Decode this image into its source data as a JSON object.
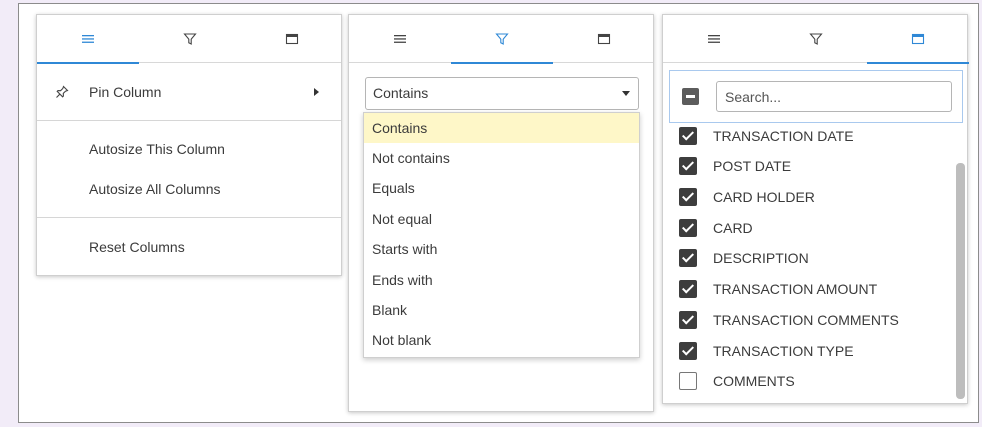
{
  "colors": {
    "accent": "#2f88d6",
    "selected_option": "#fef7c8",
    "checkbox": "#3d3d3d"
  },
  "tabs": [
    {
      "icon": "menu-lines-icon"
    },
    {
      "icon": "filter-funnel-icon"
    },
    {
      "icon": "columns-icon"
    }
  ],
  "general_menu": {
    "pin_column": "Pin Column",
    "autosize_this": "Autosize This Column",
    "autosize_all": "Autosize All Columns",
    "reset_columns": "Reset Columns"
  },
  "filter": {
    "selected": "Contains",
    "options": [
      "Contains",
      "Not contains",
      "Equals",
      "Not equal",
      "Starts with",
      "Ends with",
      "Blank",
      "Not blank"
    ]
  },
  "columns": {
    "search_placeholder": "Search...",
    "items": [
      {
        "label": "TRANSACTION DATE",
        "checked": true
      },
      {
        "label": "POST DATE",
        "checked": true
      },
      {
        "label": "CARD HOLDER",
        "checked": true
      },
      {
        "label": "CARD",
        "checked": true
      },
      {
        "label": "DESCRIPTION",
        "checked": true
      },
      {
        "label": "TRANSACTION AMOUNT",
        "checked": true
      },
      {
        "label": "TRANSACTION COMMENTS",
        "checked": true
      },
      {
        "label": "TRANSACTION TYPE",
        "checked": true
      },
      {
        "label": "COMMENTS",
        "checked": false
      }
    ]
  }
}
